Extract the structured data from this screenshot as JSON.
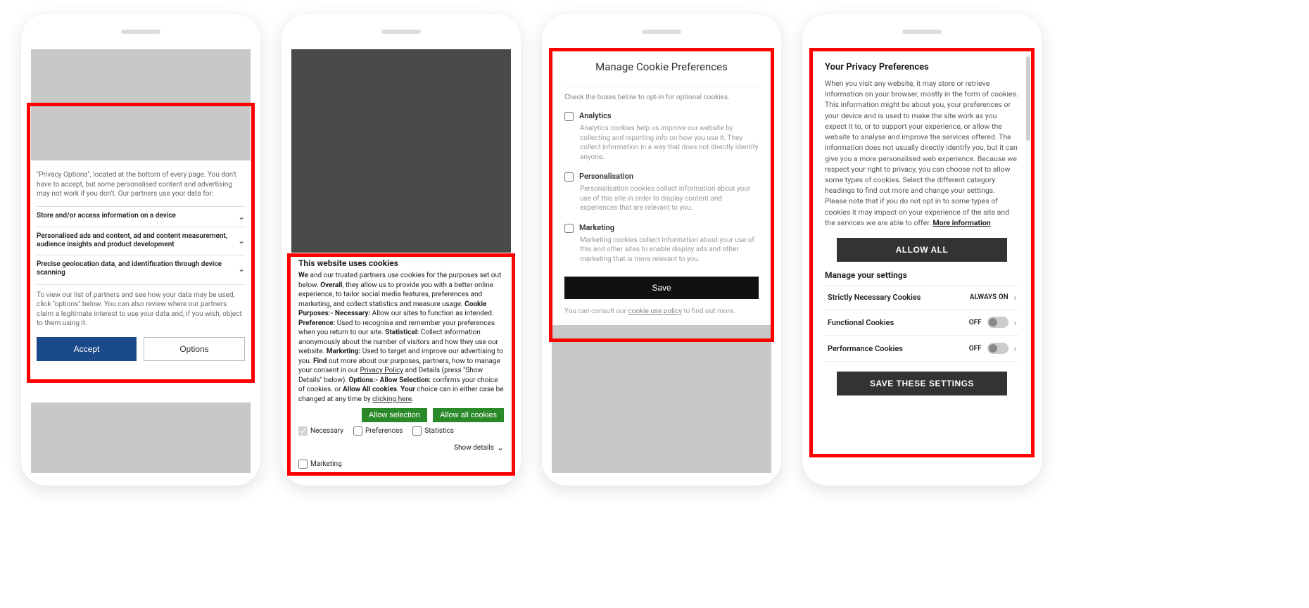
{
  "phone1": {
    "intro": "\"Privacy Options\", located at the bottom of every page. You don't have to accept, but some personalised content and advertising may not work if you don't. Our partners use your data for:",
    "rows": [
      "Store and/or access information on a device",
      "Personalised ads and content, ad and content measurement, audience insights and product development",
      "Precise geolocation data, and identification through device scanning"
    ],
    "note": "To view our list of partners and see how your data may be used, click \"options\" below. You can also review where our partners claim a legitimate interest to use your data and, if you wish, object to them using it.",
    "accept": "Accept",
    "options": "Options"
  },
  "phone2": {
    "title": "This website uses cookies",
    "b_we": "We",
    "t_we": " and our trusted partners use cookies for the purposes set out below. ",
    "b_overall": "Overall",
    "t_overall": ", they allow us to provide you with a better online experience, to tailor social media features, preferences and marketing, and collect statistics and measure usage. ",
    "b_cp": "Cookie Purposes:- Necessary:",
    "t_cp": " Allow our sites to function as intended. ",
    "b_pref": "Preference:",
    "t_pref": " Used to recognise and remember your preferences when you return to our site. ",
    "b_stat": "Statistical:",
    "t_stat": " Collect information anonymously about the number of visitors and how they use our website. ",
    "b_mkt": "Marketing:",
    "t_mkt": " Used to target and improve our advertising to you. ",
    "b_find": "Find",
    "t_find": " out more about our purposes, partners, how to manage your consent in our ",
    "l_pp": "Privacy Policy",
    "t_details": " and Details (press \"Show Details\" below). ",
    "b_opt": "Options:- Allow Selection:",
    "t_opt": " confirms your choice of cookies. or ",
    "b_allowall": "Allow All cookies",
    "t_allowall": ". ",
    "b_your": "Your",
    "t_your": " choice can in either case be changed at any time by ",
    "l_click": "clicking here",
    "btn_sel": "Allow selection",
    "btn_all": "Allow all cookies",
    "chk_nec": "Necessary",
    "chk_pref": "Preferences",
    "chk_stat": "Statistics",
    "chk_mkt": "Marketing",
    "show": "Show details"
  },
  "phone3": {
    "title": "Manage Cookie Preferences",
    "sub": "Check the boxes below to opt-in for optional cookies.",
    "opts": [
      {
        "label": "Analytics",
        "desc": "Analytics cookies help us improve our website by collecting and reporting info on how you use it. They collect information in a way that does not directly identify anyone."
      },
      {
        "label": "Personalisation",
        "desc": "Personalisation cookies collect information about your use of this site in order to display content and experiences that are relevant to you."
      },
      {
        "label": "Marketing",
        "desc": "Marketing cookies collect information about your use of this and other sites to enable display ads and other marketing that is more relevant to you."
      }
    ],
    "save": "Save",
    "foot_pre": "You can consult our ",
    "foot_link": "cookie use policy",
    "foot_post": " to find out more."
  },
  "phone4": {
    "title": "Your Privacy Preferences",
    "body": "When you visit any website, it may store or retrieve information on your browser, mostly in the form of cookies. This information might be about you, your preferences or your device and is used to make the site work as you expect it to, or to support your experience, or allow the website to analyse and improve the services offered. The information does not usually directly identify you, but it can give you a more personalised web experience. Because we respect your right to privacy, you can choose not to allow some types of cookies. Select the different category headings to find out more and change your settings. Please note that if you do not opt in to some types of cookies it may impact on your experience of the site and the services we are able to offer.  ",
    "more": "More information",
    "allow": "ALLOW ALL",
    "manage": "Manage your settings",
    "rows": [
      {
        "label": "Strictly Necessary Cookies",
        "state": "ALWAYS ON"
      },
      {
        "label": "Functional Cookies",
        "state": "OFF"
      },
      {
        "label": "Performance Cookies",
        "state": "OFF"
      }
    ],
    "save": "SAVE THESE SETTINGS"
  }
}
